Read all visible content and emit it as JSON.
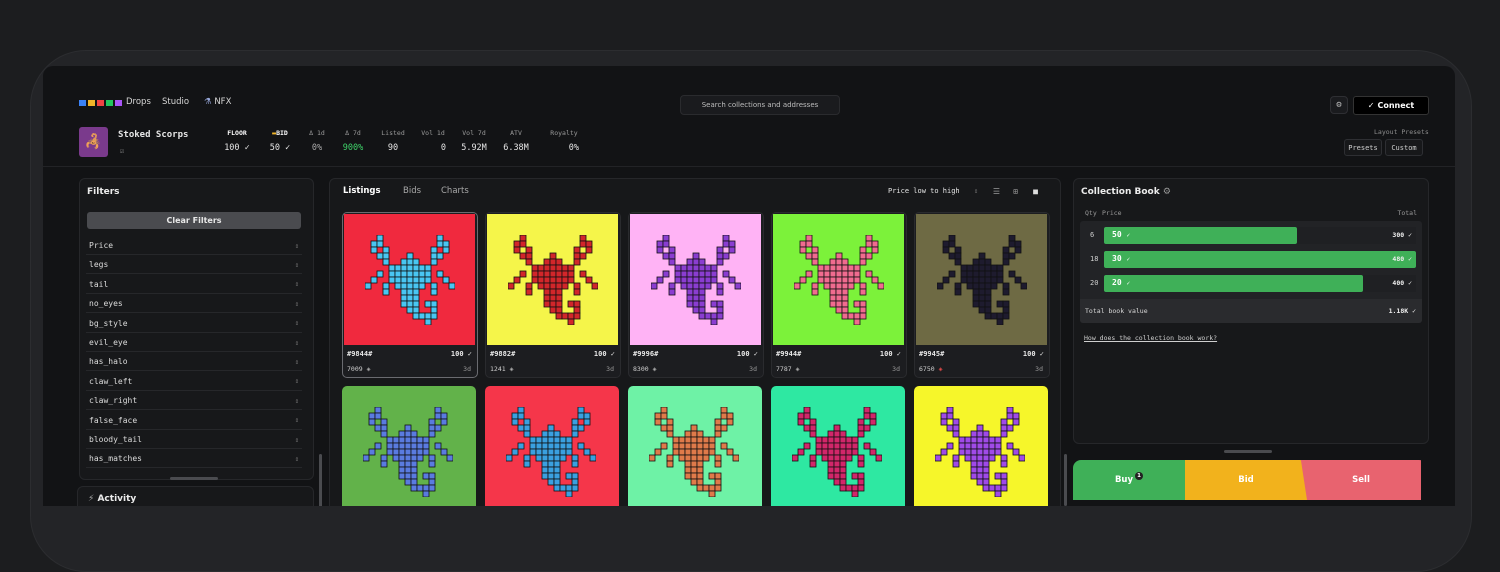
{
  "nav": {
    "logo_colors": [
      "#3b82f6",
      "#f0b429",
      "#ef4444",
      "#22c55e",
      "#a855f7"
    ],
    "items": [
      "Drops",
      "Studio",
      "NFX"
    ],
    "search_placeholder": "Search collections and addresses",
    "connect_label": "Connect"
  },
  "collection": {
    "name": "Stoked Scorps",
    "stats": [
      {
        "label": "FLOOR",
        "value": "100"
      },
      {
        "label": "BID",
        "value": "50"
      },
      {
        "label": "Δ 1d",
        "value": "0%"
      },
      {
        "label": "Δ 7d",
        "value": "900%"
      },
      {
        "label": "Listed",
        "value": "90"
      },
      {
        "label": "Vol 1d",
        "value": "0"
      },
      {
        "label": "Vol 7d",
        "value": "5.92M"
      },
      {
        "label": "ATV",
        "value": "6.38M"
      },
      {
        "label": "Royalty",
        "value": "0%"
      }
    ],
    "layout_presets_label": "Layout Presets",
    "presets_label": "Presets",
    "custom_label": "Custom"
  },
  "filters": {
    "title": "Filters",
    "clear_label": "Clear Filters",
    "items": [
      "Price",
      "legs",
      "tail",
      "no_eyes",
      "bg_style",
      "evil_eye",
      "has_halo",
      "claw_left",
      "claw_right",
      "false_face",
      "bloody_tail",
      "has_matches"
    ]
  },
  "activity": {
    "title": "Activity"
  },
  "listings": {
    "tabs": [
      "Listings",
      "Bids",
      "Charts"
    ],
    "sort": "Price low to high",
    "cards": [
      {
        "id": "#9844#",
        "price": "100",
        "rank": "7009",
        "age": "3d",
        "bg": "#f0293e",
        "fg": "#49c6f2"
      },
      {
        "id": "#9882#",
        "price": "100",
        "rank": "1241",
        "age": "3d",
        "bg": "#f5f54a",
        "fg": "#d2262a"
      },
      {
        "id": "#9996#",
        "price": "100",
        "rank": "8300",
        "age": "3d",
        "bg": "#ffb3f5",
        "fg": "#8a3dd1"
      },
      {
        "id": "#9944#",
        "price": "100",
        "rank": "7787",
        "age": "3d",
        "bg": "#7cf23a",
        "fg": "#f06b8f"
      },
      {
        "id": "#9945#",
        "price": "100",
        "rank": "6750",
        "age": "3d",
        "bg": "#6e6a44",
        "fg": "#1e1b2e"
      }
    ],
    "row2": [
      {
        "bg": "#62b24a",
        "fg": "#5a7be0"
      },
      {
        "bg": "#f5364a",
        "fg": "#3aa0e0"
      },
      {
        "bg": "#6ef2a6",
        "fg": "#e07a4a"
      },
      {
        "bg": "#2ee8a2",
        "fg": "#d2266a"
      },
      {
        "bg": "#f6f62a",
        "fg": "#a04ae8"
      }
    ]
  },
  "book": {
    "title": "Collection Book",
    "col_qty": "Qty",
    "col_price": "Price",
    "col_total": "Total",
    "rows": [
      {
        "qty": "6",
        "price": "50",
        "total": "300",
        "fill": 0.62
      },
      {
        "qty": "18",
        "price": "30",
        "total": "480",
        "fill": 1.0
      },
      {
        "qty": "20",
        "price": "20",
        "total": "400",
        "fill": 0.83
      }
    ],
    "total_label": "Total book value",
    "total_value": "1.18K",
    "how_link": "How does the collection book work?"
  },
  "actions": {
    "buy_label": "Buy",
    "buy_badge": "1",
    "bid_label": "Bid",
    "sell_label": "Sell",
    "buy_color": "#3fb058",
    "bid_color": "#f2b21c",
    "sell_color": "#e8636f"
  }
}
